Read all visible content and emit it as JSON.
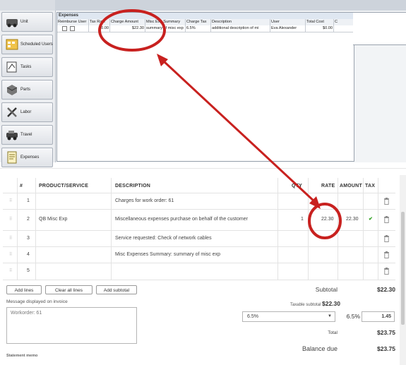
{
  "app": {
    "sidebar": [
      {
        "label": "Unit",
        "icon": "unit-icon"
      },
      {
        "label": "Scheduled Users",
        "icon": "scheduled-users-icon"
      },
      {
        "label": "Tasks",
        "icon": "tasks-icon"
      },
      {
        "label": "Parts",
        "icon": "parts-icon"
      },
      {
        "label": "Labor",
        "icon": "labor-icon"
      },
      {
        "label": "Travel",
        "icon": "travel-icon"
      },
      {
        "label": "Expenses",
        "icon": "expenses-icon"
      }
    ],
    "expenses": {
      "title": "Expenses",
      "columns": [
        "Reimburse User",
        "Tax Rate",
        "Charge Amount",
        "Misc Exp Summary",
        "Charge Tax",
        "Description",
        "User",
        "Total Cost",
        "C"
      ],
      "row": [
        "",
        "$0.00",
        "$22.30",
        "summary of misc exp",
        "6.5%",
        "additional description of mi",
        "Eva Alexander",
        "$0.00",
        ""
      ]
    }
  },
  "invoice": {
    "columns": {
      "num": "#",
      "product": "PRODUCT/SERVICE",
      "description": "DESCRIPTION",
      "qty": "QTY",
      "rate": "RATE",
      "amount": "AMOUNT",
      "tax": "TAX"
    },
    "rows": [
      {
        "num": "1",
        "product": "",
        "description": "Charges for work order: 61",
        "qty": "",
        "rate": "",
        "amount": "",
        "tax": ""
      },
      {
        "num": "2",
        "product": "QB Misc Exp",
        "description": "Miscellaneous expenses purchase on behalf of the customer",
        "qty": "1",
        "rate": "22.30",
        "amount": "22.30",
        "tax": "✔"
      },
      {
        "num": "3",
        "product": "",
        "description": "Service requested: Check of network cables",
        "qty": "",
        "rate": "",
        "amount": "",
        "tax": ""
      },
      {
        "num": "4",
        "product": "",
        "description": "Misc Expenses Summary: summary of misc exp",
        "qty": "",
        "rate": "",
        "amount": "",
        "tax": ""
      },
      {
        "num": "5",
        "product": "",
        "description": "",
        "qty": "",
        "rate": "",
        "amount": "",
        "tax": ""
      }
    ],
    "buttons": {
      "add_lines": "Add lines",
      "clear_all": "Clear all lines",
      "add_subtotal": "Add subtotal"
    },
    "message_label": "Message displayed on invoice",
    "message_value": "Workorder: 61",
    "statement_memo_label": "Statement memo",
    "totals": {
      "subtotal_label": "Subtotal",
      "subtotal_value": "$22.30",
      "taxable_label": "Taxable subtotal",
      "taxable_value": "$22.30",
      "tax_rate_select": "6.5%",
      "tax_rate_display": "6.5%",
      "tax_amount": "1.45",
      "total_label": "Total",
      "total_value": "$23.75",
      "balance_label": "Balance due",
      "balance_value": "$23.75"
    }
  },
  "colors": {
    "annotation": "#c8211f",
    "checkmark": "#2ca01c"
  }
}
